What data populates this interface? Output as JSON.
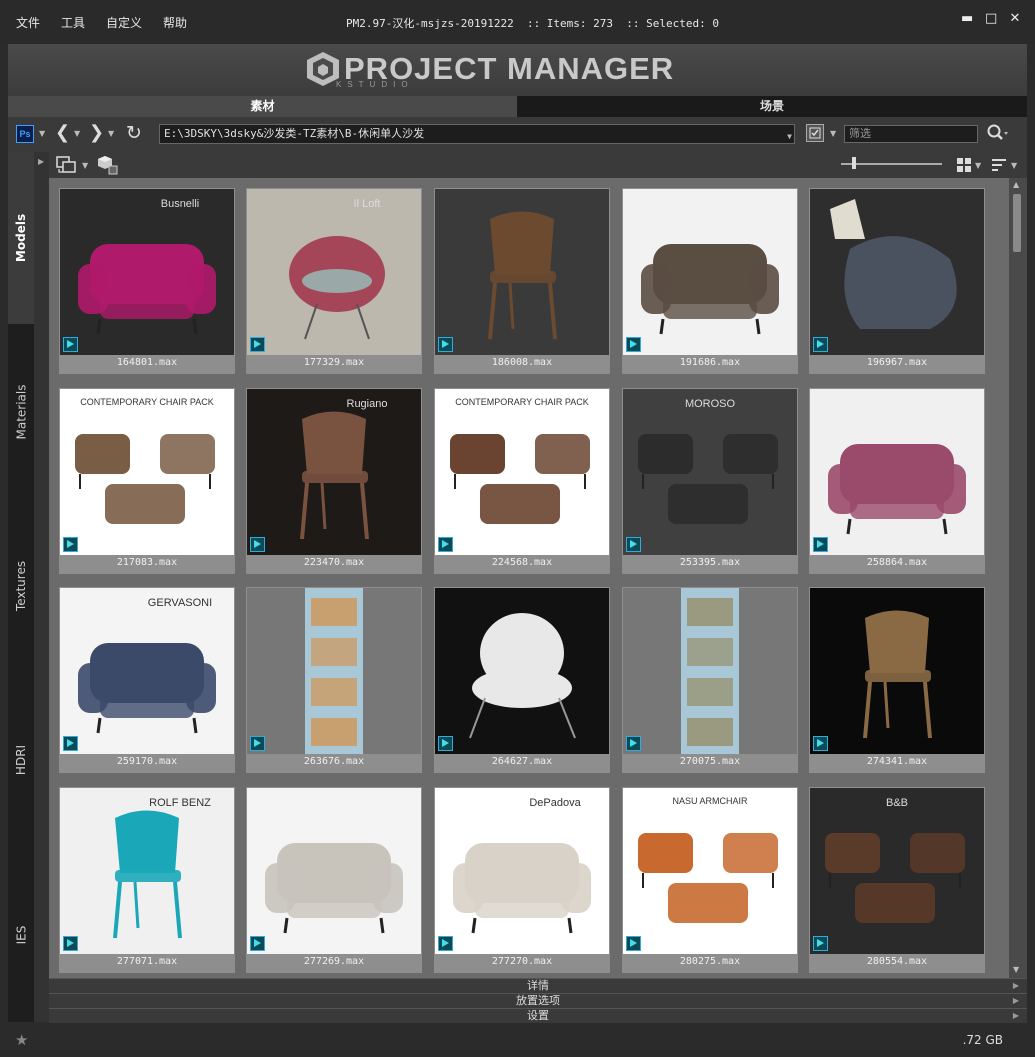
{
  "menu": [
    "文件",
    "工具",
    "自定义",
    "帮助"
  ],
  "title_info": "PM2.97-汉化-msjzs-20191222  :: Items: 273  :: Selected: 0",
  "window_buttons": [
    "minimize",
    "maximize",
    "close"
  ],
  "logo": {
    "text": "PROJECT MANAGER",
    "sub": "KSTUDIO"
  },
  "tabs": {
    "assets": "素材",
    "scenes": "场景"
  },
  "nav": {
    "path": "E:\\3DSKY\\3dsky&沙发类-TZ素材\\B-休闲单人沙发",
    "filter_placeholder": "筛选"
  },
  "sidebar": [
    "Models",
    "Materials",
    "Textures",
    "HDRI",
    "IES"
  ],
  "items": [
    {
      "name": "164801.max",
      "bg": "#2a2a2a",
      "fg": "#b01a6a",
      "kind": "sofa"
    },
    {
      "name": "177329.max",
      "bg": "#bdb8ae",
      "fg": "#a54558",
      "kind": "egg"
    },
    {
      "name": "186008.max",
      "bg": "#3a3a3a",
      "fg": "#6b4a30",
      "kind": "chair"
    },
    {
      "name": "191686.max",
      "bg": "#f2f2f2",
      "fg": "#5a4d42",
      "kind": "sofa"
    },
    {
      "name": "196967.max",
      "bg": "#2e2e2e",
      "fg": "#4a5260",
      "kind": "bag"
    },
    {
      "name": "217083.max",
      "bg": "#ffffff",
      "fg": "#7a5d45",
      "kind": "set"
    },
    {
      "name": "223470.max",
      "bg": "#1e1a18",
      "fg": "#7a5240",
      "kind": "chair"
    },
    {
      "name": "224568.max",
      "bg": "#ffffff",
      "fg": "#6a4430",
      "kind": "set"
    },
    {
      "name": "253395.max",
      "bg": "#404040",
      "fg": "#2c2c2c",
      "kind": "set"
    },
    {
      "name": "258864.max",
      "bg": "#f0f0f0",
      "fg": "#9a4a6a",
      "kind": "sofa"
    },
    {
      "name": "259170.max",
      "bg": "#f4f4f4",
      "fg": "#3c4a6a",
      "kind": "sofa"
    },
    {
      "name": "263676.max",
      "bg": "#777777",
      "fg": "#c8a070",
      "kind": "strip"
    },
    {
      "name": "264627.max",
      "bg": "#111111",
      "fg": "#e8e8e8",
      "kind": "fur"
    },
    {
      "name": "270075.max",
      "bg": "#777777",
      "fg": "#9a9a80",
      "kind": "strip"
    },
    {
      "name": "274341.max",
      "bg": "#0a0a0a",
      "fg": "#8a6a45",
      "kind": "chair"
    },
    {
      "name": "277071.max",
      "bg": "#f0f0f0",
      "fg": "#1aa8b8",
      "kind": "chair"
    },
    {
      "name": "277269.max",
      "bg": "#f4f4f4",
      "fg": "#c8c4bc",
      "kind": "sofa"
    },
    {
      "name": "277270.max",
      "bg": "#ffffff",
      "fg": "#d8d2c8",
      "kind": "sofa"
    },
    {
      "name": "280275.max",
      "bg": "#ffffff",
      "fg": "#c86a30",
      "kind": "set"
    },
    {
      "name": "280554.max",
      "bg": "#2a2a2a",
      "fg": "#5a3a28",
      "kind": "set"
    }
  ],
  "thumb_texts": {
    "164801.max": "Busnelli",
    "177329.max": "Il Loft",
    "217083.max": "CONTEMPORARY CHAIR PACK",
    "223470.max": "Rugiano",
    "224568.max": "CONTEMPORARY CHAIR PACK",
    "253395.max": "MOROSO",
    "259170.max": "GERVASONI",
    "277071.max": "ROLF BENZ",
    "277270.max": "DePadova",
    "280275.max": "NASU ARMCHAIR",
    "280554.max": "B&B"
  },
  "panels": [
    "详情",
    "放置选项",
    "设置"
  ],
  "status": {
    "disk": ".72 GB"
  },
  "colors": {
    "accent": "#3aa0ff",
    "grid_bg": "#6b6b6b",
    "tab_active": "#4a4a4a"
  }
}
